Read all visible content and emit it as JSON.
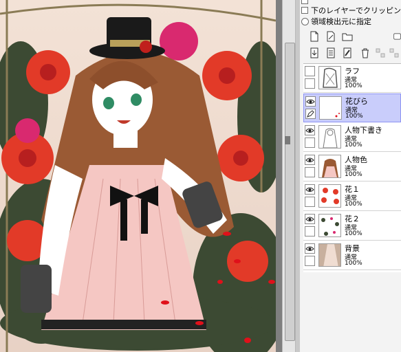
{
  "layer_options": {
    "clipping_label": "下のレイヤーでクリッピング",
    "region_label": "領域検出元に指定"
  },
  "toolbar": {
    "row1": [
      "new-layer-icon",
      "new-linework-layer-icon",
      "new-folder-icon"
    ],
    "row2": [
      "transfer-down-icon",
      "merge-down-icon",
      "clear-layer-icon",
      "delete-layer-icon"
    ]
  },
  "layers": [
    {
      "name": "ラフ",
      "mode": "通常",
      "opacity": "100%",
      "visible": false,
      "selected": false
    },
    {
      "name": "花びら",
      "mode": "通常",
      "opacity": "100%",
      "visible": true,
      "selected": true
    },
    {
      "name": "人物下書き",
      "mode": "通常",
      "opacity": "100%",
      "visible": true,
      "selected": false
    },
    {
      "name": "人物色",
      "mode": "通常",
      "opacity": "100%",
      "visible": true,
      "selected": false
    },
    {
      "name": "花１",
      "mode": "通常",
      "opacity": "100%",
      "visible": true,
      "selected": false
    },
    {
      "name": "花２",
      "mode": "通常",
      "opacity": "100%",
      "visible": true,
      "selected": false
    },
    {
      "name": "背景",
      "mode": "通常",
      "opacity": "100%",
      "visible": true,
      "selected": false
    }
  ],
  "colors": {
    "selected_row": "#c9cdfb",
    "selected_border": "#8d93f2",
    "rose": "#e23a28",
    "hair": "#9a5a34",
    "dress": "#f5c7c3"
  }
}
